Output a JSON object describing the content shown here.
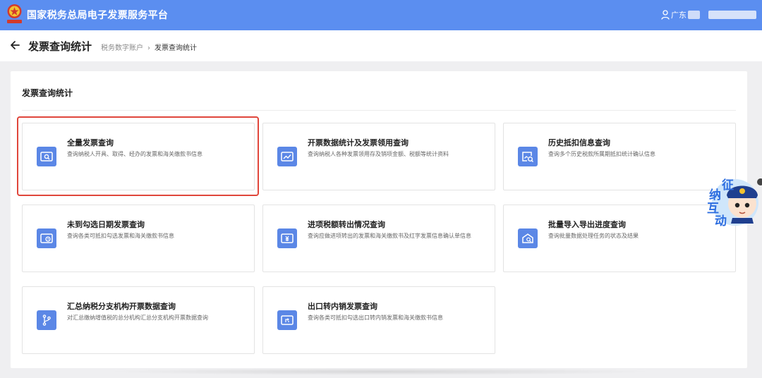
{
  "header": {
    "platform_title": "国家税务总局电子发票服务平台",
    "user_region": "广东",
    "accent_color": "#5b8ef0"
  },
  "titlebar": {
    "page_title": "发票查询统计",
    "breadcrumb": [
      "税务数字账户",
      "发票查询统计"
    ]
  },
  "panel": {
    "title": "发票查询统计"
  },
  "cards": [
    {
      "title": "全量发票查询",
      "desc": "查询纳税人开具、取得、经办的发票和海关缴款书信息",
      "icon": "invoice-search-icon"
    },
    {
      "title": "开票数据统计及发票领用查询",
      "desc": "查询纳税人各种发票领用存及销项金额、税额等统计资料",
      "icon": "trend-chart-icon"
    },
    {
      "title": "历史抵扣信息查询",
      "desc": "查询多个历史税款所属期抵扣统计确认信息",
      "icon": "history-search-icon"
    },
    {
      "title": "未到勾选日期发票查询",
      "desc": "查询各类可抵扣勾选发票和海关缴款书信息",
      "icon": "clock-invoice-icon"
    },
    {
      "title": "进项税额转出情况查询",
      "desc": "查询应做进项转出的发票和海关缴款书及红字发票信息确认单信息",
      "icon": "yuan-transfer-icon"
    },
    {
      "title": "批量导入导出进度查询",
      "desc": "查询批量数据处理任务的状态及结果",
      "icon": "batch-progress-icon"
    },
    {
      "title": "汇总纳税分支机构开票数据查询",
      "desc": "对汇总缴纳增值税的总分机构汇总分支机构开票数据查询",
      "icon": "branch-icon"
    },
    {
      "title": "出口转内销发票查询",
      "desc": "查询各类可抵扣勾选出口转内销发票和海关缴款书信息",
      "icon": "export-return-icon"
    }
  ],
  "assistant": {
    "chars": [
      "征",
      "纳",
      "互",
      "动"
    ]
  }
}
